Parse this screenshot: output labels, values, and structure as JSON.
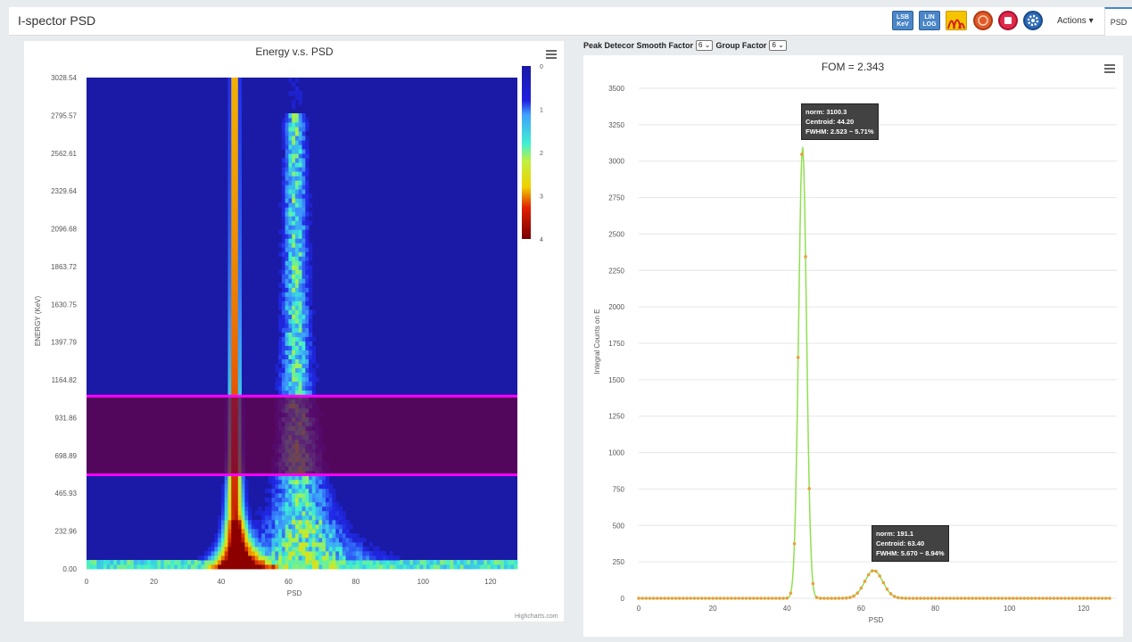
{
  "app": {
    "title": "I-spector PSD"
  },
  "toolbar": {
    "lsb_top": "LSB",
    "lsb_bottom": "KeV",
    "lin_top": "LIN",
    "lin_bottom": "LOG",
    "actions_label": "Actions",
    "psd_tab": "PSD"
  },
  "controls": {
    "smooth_label": "Peak Detecor Smooth Factor",
    "smooth_value": "6",
    "group_label": "Group Factor",
    "group_value": "6"
  },
  "left_chart": {
    "credit": "Highcharts.com",
    "chart_data": {
      "type": "heatmap",
      "title": "Energy v.s. PSD",
      "xlabel": "PSD",
      "ylabel": "ENERGY (KeV)",
      "x_ticks": [
        "0",
        "20",
        "40",
        "60",
        "80",
        "100",
        "120"
      ],
      "y_ticks": [
        "0.00",
        "232.96",
        "465.93",
        "698.89",
        "931.86",
        "1164.82",
        "1397.79",
        "1630.75",
        "1863.72",
        "2096.68",
        "2329.64",
        "2562.61",
        "2795.57",
        "3028.54"
      ],
      "colorbar_ticks": [
        "0",
        "1",
        "2",
        "3",
        "4"
      ],
      "xlim": [
        0,
        128
      ],
      "ylim": [
        0,
        3028.54
      ],
      "selection_band": [
        580,
        1065
      ],
      "colors": {
        "band_line": "#ff00ff",
        "background": "#1a1aa6"
      }
    }
  },
  "right_chart": {
    "chart_data": {
      "type": "line",
      "title": "FOM = 2.343",
      "xlabel": "PSD",
      "ylabel": "Integral Counts on E",
      "x_ticks": [
        "0",
        "20",
        "40",
        "60",
        "80",
        "100",
        "120"
      ],
      "y_ticks": [
        "0",
        "250",
        "500",
        "750",
        "1000",
        "1250",
        "1500",
        "1750",
        "2000",
        "2250",
        "2500",
        "2750",
        "3000",
        "3250",
        "3500"
      ],
      "xlim": [
        0,
        128
      ],
      "ylim": [
        0,
        3500
      ],
      "peaks": [
        {
          "norm": 3100.3,
          "centroid": 44.2,
          "sigma": 1.07
        },
        {
          "norm": 191.1,
          "centroid": 63.4,
          "sigma": 2.41
        }
      ],
      "colors": {
        "line": "#90e050",
        "points": "#e8a040"
      }
    },
    "tooltips": [
      {
        "l1": "norm: 3100.3",
        "l2": "Centroid: 44.20",
        "l3": "FWHM: 2.523 ~ 5.71%"
      },
      {
        "l1": "norm: 191.1",
        "l2": "Centroid: 63.40",
        "l3": "FWHM: 5.670 ~ 8.94%"
      }
    ]
  }
}
